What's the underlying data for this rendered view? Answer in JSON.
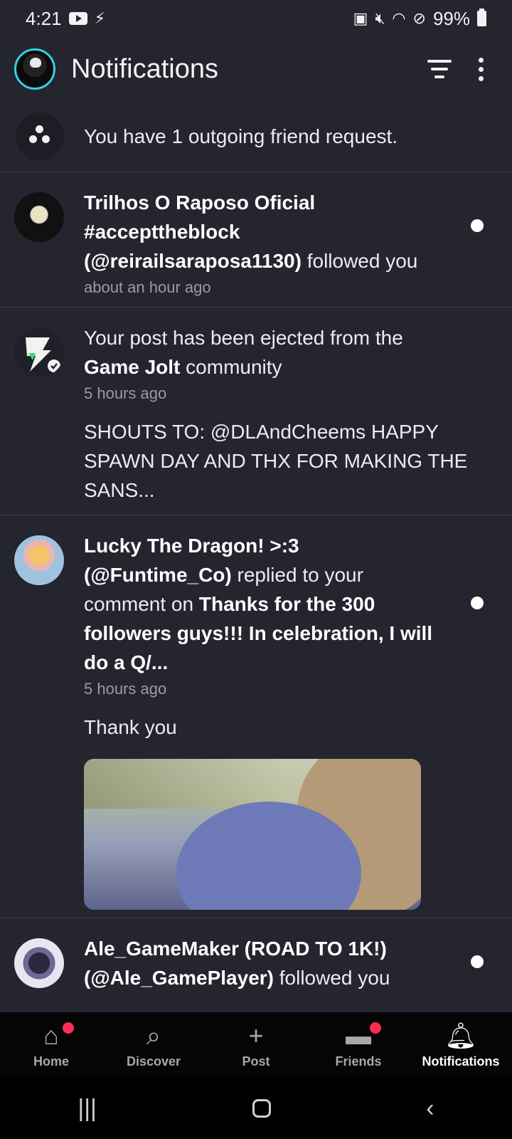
{
  "status_bar": {
    "time": "4:21",
    "battery": "99%",
    "icons": [
      "youtube-icon",
      "game-jolt-icon",
      "battery-saver-icon",
      "mute-icon",
      "wifi-icon",
      "dnd-icon",
      "battery-icon"
    ]
  },
  "header": {
    "title": "Notifications",
    "icons": [
      "filter-icon",
      "more-vert-icon"
    ]
  },
  "friend_request": {
    "text": "You have 1 outgoing friend request."
  },
  "notifications": [
    {
      "user": "Trilhos O Raposo Oficial",
      "user2": "#accepttheblock",
      "handle": "(@reirailsaraposa1130)",
      "action": " followed you",
      "time": "about an hour ago",
      "unread": true
    },
    {
      "text_prefix": "Your post has been ejected from the",
      "community": "Game Jolt",
      "text_suffix": " community",
      "time": "5 hours ago",
      "quote_line1": "SHOUTS TO: @DLAndCheems HAPPY",
      "quote_line2": "SPAWN DAY AND THX FOR MAKING THE",
      "quote_line3": "SANS...",
      "unread": false
    },
    {
      "user": "Lucky The Dragon!  >:3",
      "handle": "(@Funtime_Co)",
      "action": " replied to your",
      "action2": "comment on ",
      "post_title1": "Thanks for the 300",
      "post_title2": "followers guys!!! In celebration, I will",
      "post_title3": "do a Q/...",
      "time": "5 hours ago",
      "quote": "Thank you",
      "unread": true
    },
    {
      "user": "Ale_GameMaker (ROAD TO 1K!)",
      "handle": "(@Ale_GamePlayer)",
      "action": " followed you",
      "unread": true
    }
  ],
  "bottom_nav": [
    {
      "label": "Home",
      "icon": "home-icon",
      "badge": true
    },
    {
      "label": "Discover",
      "icon": "search-icon",
      "badge": false
    },
    {
      "label": "Post",
      "icon": "plus-icon",
      "badge": false
    },
    {
      "label": "Friends",
      "icon": "chat-icon",
      "badge": true
    },
    {
      "label": "Notifications",
      "icon": "bell-icon",
      "badge": false,
      "active": true
    }
  ],
  "colors": {
    "background": "#24252f",
    "divider": "#3b3c47",
    "badge": "#ff2d55",
    "avatar_ring": "#35d0e6"
  }
}
